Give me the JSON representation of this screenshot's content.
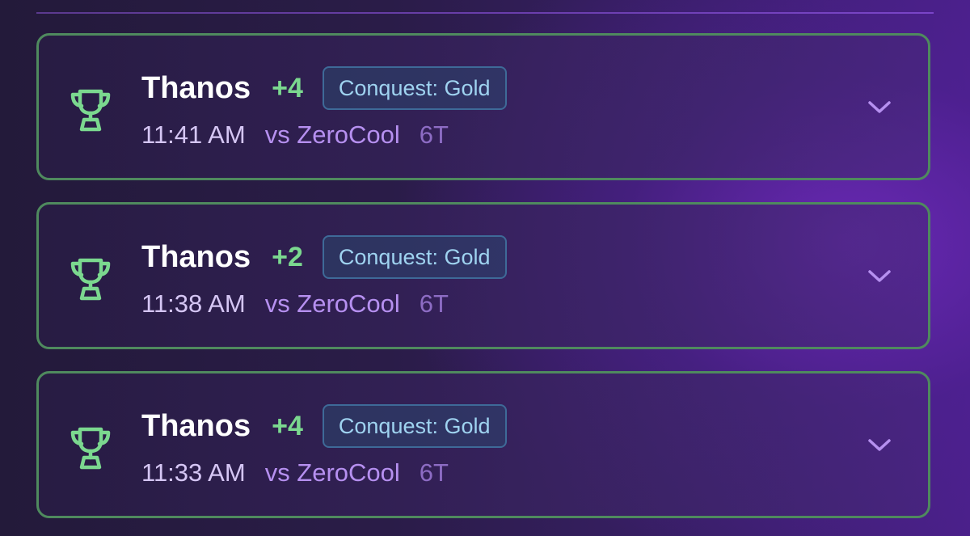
{
  "matches": [
    {
      "player": "Thanos",
      "score": "+4",
      "badge": "Conquest: Gold",
      "time": "11:41 AM",
      "opponent": "vs ZeroCool",
      "turns": "6T"
    },
    {
      "player": "Thanos",
      "score": "+2",
      "badge": "Conquest: Gold",
      "time": "11:38 AM",
      "opponent": "vs ZeroCool",
      "turns": "6T"
    },
    {
      "player": "Thanos",
      "score": "+4",
      "badge": "Conquest: Gold",
      "time": "11:33 AM",
      "opponent": "vs ZeroCool",
      "turns": "6T"
    }
  ],
  "icons": {
    "result": "trophy-icon",
    "expand": "chevron-down-icon"
  },
  "colors": {
    "win_border": "#4f8a5e",
    "score": "#7bd88f",
    "badge_text": "#9fd3f0",
    "opponent": "#b690f0",
    "chevron": "#b690f0"
  }
}
